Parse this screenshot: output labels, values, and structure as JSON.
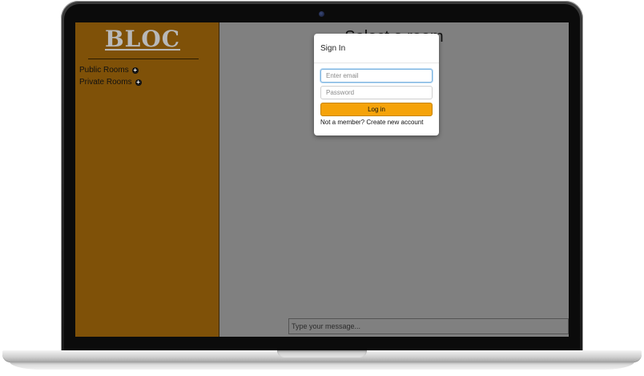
{
  "sidebar": {
    "logo": "BLOC",
    "items": [
      {
        "label": "Public Rooms",
        "icon": "plus-circle-icon"
      },
      {
        "label": "Private Rooms",
        "icon": "plus-circle-icon"
      }
    ]
  },
  "main": {
    "room_title": "Select a room",
    "message_placeholder": "Type your message..."
  },
  "modal": {
    "title": "Sign In",
    "email_placeholder": "Enter email",
    "password_placeholder": "Password",
    "login_label": "Log in",
    "signup_prompt": "Not a member?",
    "signup_link": "Create new account"
  },
  "colors": {
    "sidebar_bg": "#7f5108",
    "overlay_bg": "#808080",
    "login_button": "#f5a30a"
  }
}
